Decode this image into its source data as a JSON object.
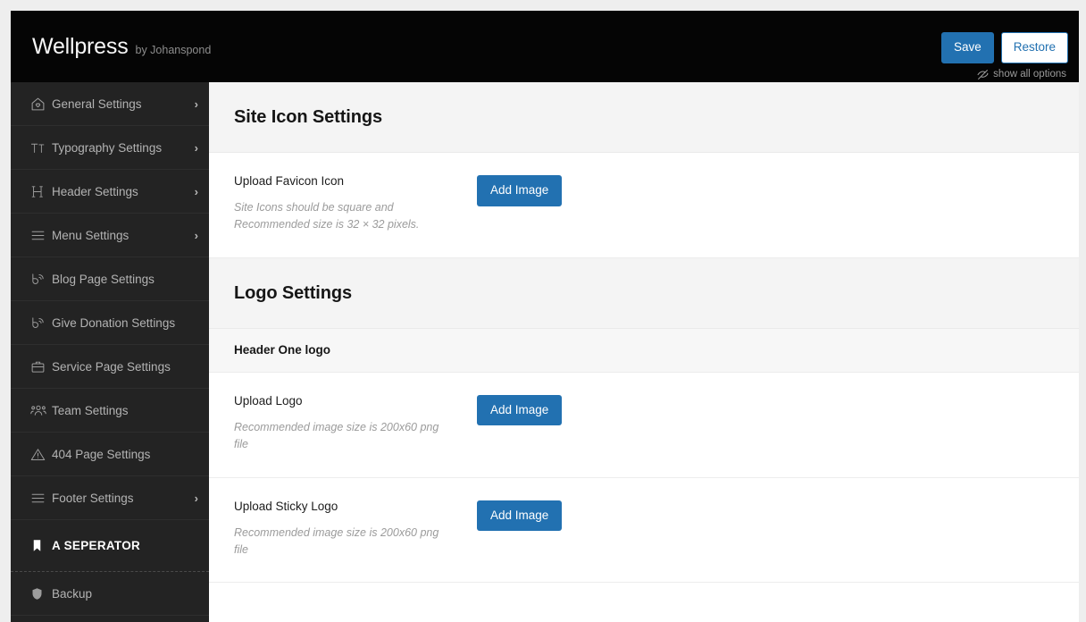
{
  "header": {
    "brand_name": "Wellpress",
    "brand_by": "by Johanspond",
    "save_label": "Save",
    "restore_label": "Restore",
    "show_all_label": "show all options",
    "show_all_icon": "eye-slash-icon",
    "accent_color": "#2271b1",
    "background_color": "#050505"
  },
  "sidebar": {
    "background_color": "#232323",
    "items": [
      {
        "label": "General Settings",
        "icon": "home-heart-icon",
        "caret": "›",
        "has_caret": true,
        "type": "nav"
      },
      {
        "label": "Typography Settings",
        "icon": "typography-icon",
        "caret": "›",
        "has_caret": true,
        "type": "nav"
      },
      {
        "label": "Header Settings",
        "icon": "heading-h-icon",
        "caret": "›",
        "has_caret": true,
        "type": "nav"
      },
      {
        "label": "Menu Settings",
        "icon": "hamburger-icon",
        "caret": "›",
        "has_caret": true,
        "type": "nav"
      },
      {
        "label": "Blog Page Settings",
        "icon": "blog-icon",
        "caret": "",
        "has_caret": false,
        "type": "nav"
      },
      {
        "label": "Give Donation Settings",
        "icon": "blog-icon",
        "caret": "",
        "has_caret": false,
        "type": "nav"
      },
      {
        "label": "Service Page Settings",
        "icon": "briefcase-icon",
        "caret": "",
        "has_caret": false,
        "type": "nav"
      },
      {
        "label": "Team Settings",
        "icon": "team-users-icon",
        "caret": "",
        "has_caret": false,
        "type": "nav"
      },
      {
        "label": "404 Page Settings",
        "icon": "warning-triangle-icon",
        "caret": "",
        "has_caret": false,
        "type": "nav"
      },
      {
        "label": "Footer Settings",
        "icon": "hamburger-icon",
        "caret": "›",
        "has_caret": true,
        "type": "nav"
      },
      {
        "label": "A SEPERATOR",
        "icon": "bookmark-icon",
        "caret": "",
        "has_caret": false,
        "type": "separator"
      },
      {
        "label": "Backup",
        "icon": "shield-icon",
        "caret": "",
        "has_caret": false,
        "type": "nav"
      }
    ]
  },
  "main": {
    "sections": [
      {
        "kind": "section-title",
        "title": "Site Icon Settings"
      },
      {
        "kind": "field",
        "title": "Upload Favicon Icon",
        "description": "Site Icons should be square and Recommended size is 32 × 32 pixels.",
        "button_label": "Add Image"
      },
      {
        "kind": "section-title",
        "title": "Logo Settings"
      },
      {
        "kind": "sub-title",
        "title": "Header One logo"
      },
      {
        "kind": "field",
        "title": "Upload Logo",
        "description": "Recommended image size is 200x60 png file",
        "button_label": "Add Image"
      },
      {
        "kind": "field",
        "title": "Upload Sticky Logo",
        "description": "Recommended image size is 200x60 png file",
        "button_label": "Add Image"
      }
    ]
  }
}
